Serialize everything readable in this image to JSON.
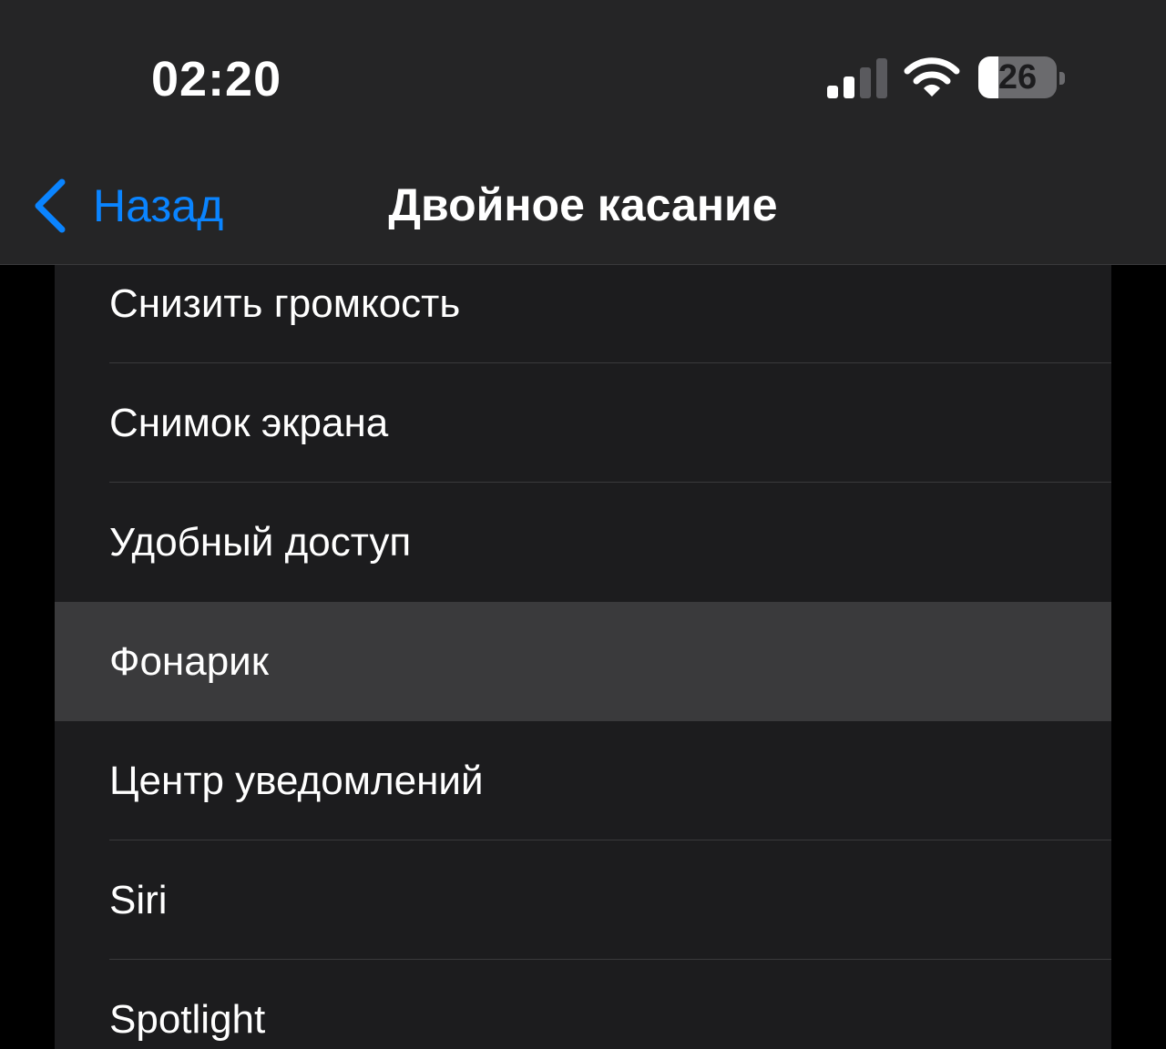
{
  "status_bar": {
    "time": "02:20",
    "battery_level": "26",
    "battery_fraction": 0.26,
    "icons": [
      "signal-icon",
      "wifi-icon",
      "battery-icon"
    ]
  },
  "nav_bar": {
    "back_label": "Назад",
    "title": "Двойное касание",
    "back_icon": "chevron-left-icon"
  },
  "list": {
    "items": [
      {
        "label": "Снизить громкость",
        "selected": false
      },
      {
        "label": "Снимок экрана",
        "selected": false
      },
      {
        "label": "Удобный доступ",
        "selected": false
      },
      {
        "label": "Фонарик",
        "selected": true
      },
      {
        "label": "Центр уведомлений",
        "selected": false
      },
      {
        "label": "Siri",
        "selected": false
      },
      {
        "label": "Spotlight",
        "selected": false
      }
    ]
  },
  "colors": {
    "accent": "#0a84ff",
    "header_bg": "#252526",
    "list_bg": "#1c1c1e",
    "selected_bg": "#3a3a3c",
    "separator": "#3a3a3c",
    "text": "#ffffff"
  }
}
